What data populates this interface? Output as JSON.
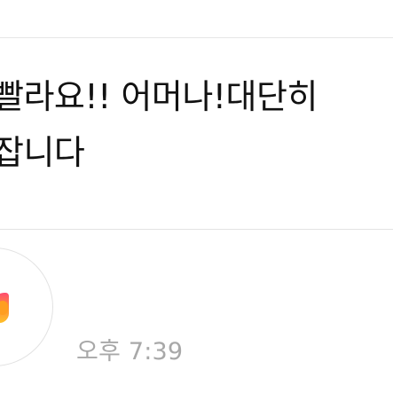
{
  "chat": {
    "message_lines": [
      "빨라요!! 어머나!대단히",
      "잡니다"
    ],
    "timestamp": "오후 7:39"
  },
  "avatar": {
    "icon": "profile-logo-icon",
    "colors": [
      "#ff4b70",
      "#ff8a3a",
      "#ffc028"
    ]
  }
}
